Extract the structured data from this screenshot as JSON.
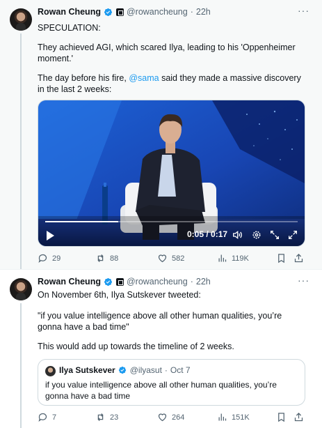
{
  "tweets": [
    {
      "author": {
        "name": "Rowan Cheung",
        "handle": "@rowancheung",
        "dot": "·",
        "time": "22h"
      },
      "more": "···",
      "text": {
        "line1": "SPECULATION:",
        "line2": "They achieved AGI, which scared Ilya, leading to his 'Oppenheimer moment.'",
        "line3_before": "The day before his fire, ",
        "line3_mention": "@sama",
        "line3_after": " said they made a massive discovery in the last 2 weeks:"
      },
      "video": {
        "time": "0:05 / 0:17",
        "progress": 0.29
      },
      "actions": {
        "replies": "29",
        "reposts": "88",
        "likes": "582",
        "views": "119K"
      }
    },
    {
      "author": {
        "name": "Rowan Cheung",
        "handle": "@rowancheung",
        "dot": "·",
        "time": "22h"
      },
      "more": "···",
      "text": {
        "line1": "On November 6th, Ilya Sutskever tweeted:",
        "line2": "\"if you value intelligence above all other human qualities, you’re gonna have a bad time\"",
        "line3": "This would add up towards the timeline of 2 weeks."
      },
      "quote": {
        "name": "Ilya Sutskever",
        "handle": "@ilyasut",
        "dot": "·",
        "date": "Oct 7",
        "text": "if you value intelligence above all other human qualities, you’re gonna have a bad time"
      },
      "actions": {
        "replies": "7",
        "reposts": "23",
        "likes": "264",
        "views": "151K"
      }
    }
  ],
  "colors": {
    "accent": "#1d9bf0",
    "text": "#0f1419",
    "muted": "#536471",
    "border": "#cfd9de"
  },
  "icons": [
    "verified-icon",
    "label-badge-icon",
    "more-icon",
    "play-icon",
    "volume-icon",
    "settings-icon",
    "fullscreen-icon",
    "reply-icon",
    "repost-icon",
    "like-icon",
    "views-icon",
    "bookmark-icon",
    "share-icon"
  ]
}
